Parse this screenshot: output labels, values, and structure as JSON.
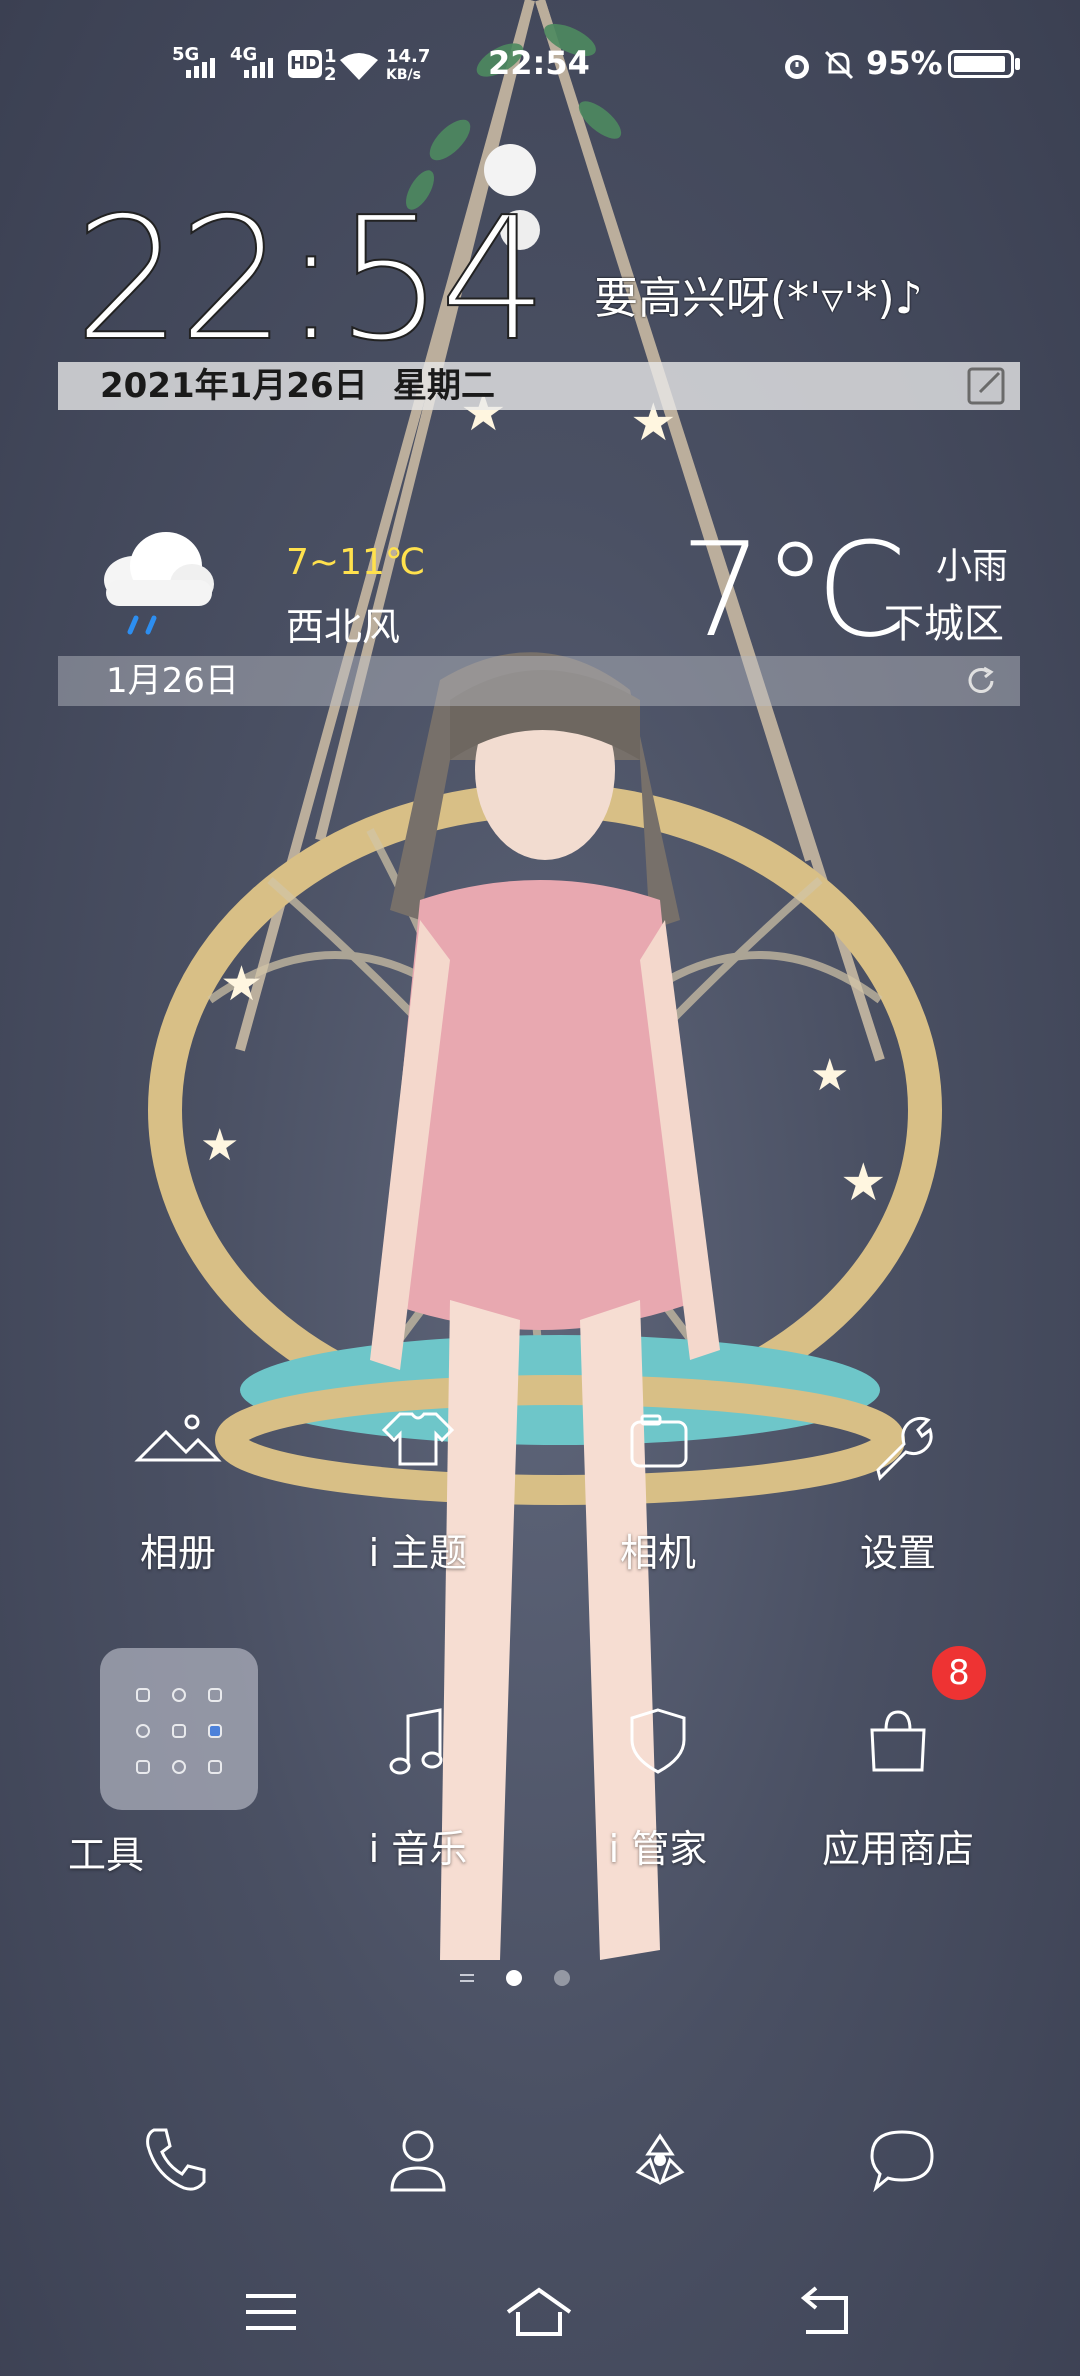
{
  "status_bar": {
    "network1": "5G",
    "network2": "4G",
    "hd_label": "HD",
    "hd_sub1": "1",
    "hd_sub2": "2",
    "speed_value": "14.7",
    "speed_unit": "KB/s",
    "time": "22:54",
    "battery_percent": "95%",
    "battery_level": 0.95,
    "icons": [
      "signal-icon",
      "wifi-icon",
      "alarm-icon",
      "mute-icon",
      "battery-icon"
    ]
  },
  "clock_widget": {
    "time": "22:54",
    "motto": "要高兴呀(*'▿'*)♪",
    "date": "2021年1月26日",
    "weekday": "星期二"
  },
  "weather_widget": {
    "temp_range": "7~11℃",
    "wind": "西北风",
    "temperature": "7℃",
    "condition": "小雨",
    "district": "下城区",
    "date": "1月26日",
    "icon": "rain-cloud-icon"
  },
  "apps_row1": [
    {
      "label": "相册",
      "icon": "gallery-icon"
    },
    {
      "label": "i 主题",
      "icon": "theme-icon"
    },
    {
      "label": "相机",
      "icon": "camera-icon"
    },
    {
      "label": "设置",
      "icon": "settings-icon"
    }
  ],
  "apps_row2": [
    {
      "label": "工具",
      "icon": "tools-folder-icon"
    },
    {
      "label": "i 音乐",
      "icon": "music-icon"
    },
    {
      "label": "i 管家",
      "icon": "shield-icon"
    },
    {
      "label": "应用商店",
      "icon": "app-store-icon",
      "badge": "8"
    }
  ],
  "page_indicator": {
    "pages": 2,
    "current": 1
  },
  "dock": [
    "phone-icon",
    "contacts-icon",
    "camera-aperture-icon",
    "messages-icon"
  ],
  "nav_bar": [
    "menu-icon",
    "home-icon",
    "back-icon"
  ],
  "colors": {
    "accent_yellow": "#ffe14d",
    "badge_red": "#ee3333"
  }
}
